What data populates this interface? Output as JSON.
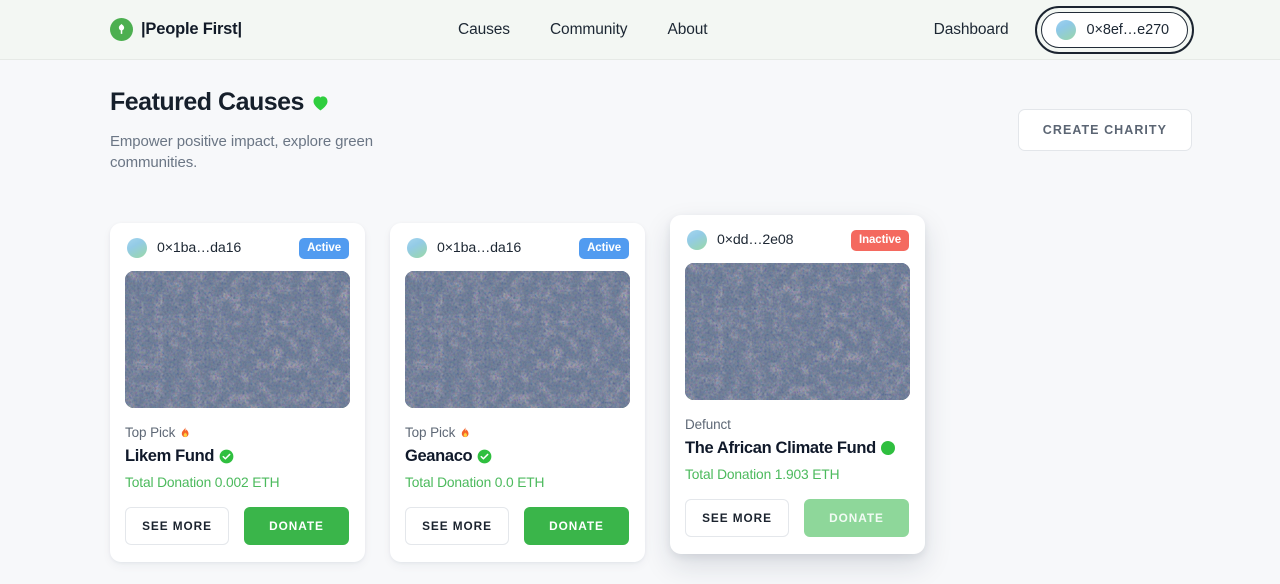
{
  "navbar": {
    "brand": "|People First|",
    "logo_icon": "leaf-logo-icon",
    "links": [
      {
        "label": "Causes"
      },
      {
        "label": "Community"
      },
      {
        "label": "About"
      }
    ],
    "dashboard_label": "Dashboard",
    "wallet_address": "0×8ef…e270",
    "wallet_avatar_icon": "wallet-avatar-icon"
  },
  "hero": {
    "title": "Featured Causes",
    "title_emoji": "green-heart-emoji",
    "subtitle": "Empower positive impact, explore green communities.",
    "create_button": "CREATE CHARITY"
  },
  "cards": [
    {
      "owner_address": "0×1ba…da16",
      "status": "Active",
      "status_kind": "active",
      "image_alt": "aerial-autumn-forest-image",
      "tag": "Top Pick",
      "tag_emoji": "fire-emoji",
      "name": "Likem Fund",
      "name_badge": "verified-check-emoji",
      "total_donation": "Total Donation 0.002 ETH",
      "see_more": "SEE MORE",
      "donate": "DONATE",
      "donate_disabled": false,
      "hovered": false
    },
    {
      "owner_address": "0×1ba…da16",
      "status": "Active",
      "status_kind": "active",
      "image_alt": "aerial-autumn-forest-image",
      "tag": "Top Pick",
      "tag_emoji": "fire-emoji",
      "name": "Geanaco",
      "name_badge": "verified-check-emoji",
      "total_donation": "Total Donation 0.0 ETH",
      "see_more": "SEE MORE",
      "donate": "DONATE",
      "donate_disabled": false,
      "hovered": false
    },
    {
      "owner_address": "0×dd…2e08",
      "status": "Inactive",
      "status_kind": "inactive",
      "image_alt": "aerial-autumn-forest-image",
      "tag": "Defunct",
      "tag_emoji": "",
      "name": "The African Climate Fund",
      "name_badge": "green-circle-emoji",
      "total_donation": "Total Donation 1.903 ETH",
      "see_more": "SEE MORE",
      "donate": "DONATE",
      "donate_disabled": true,
      "hovered": true
    }
  ],
  "colors": {
    "brand_green": "#3ab54a",
    "accent_blue": "#519bf0",
    "danger_red": "#f4695f",
    "donation_green": "#4cba5d",
    "page_bg": "#f7f8fa",
    "navbar_bg": "#f3f7f3"
  }
}
